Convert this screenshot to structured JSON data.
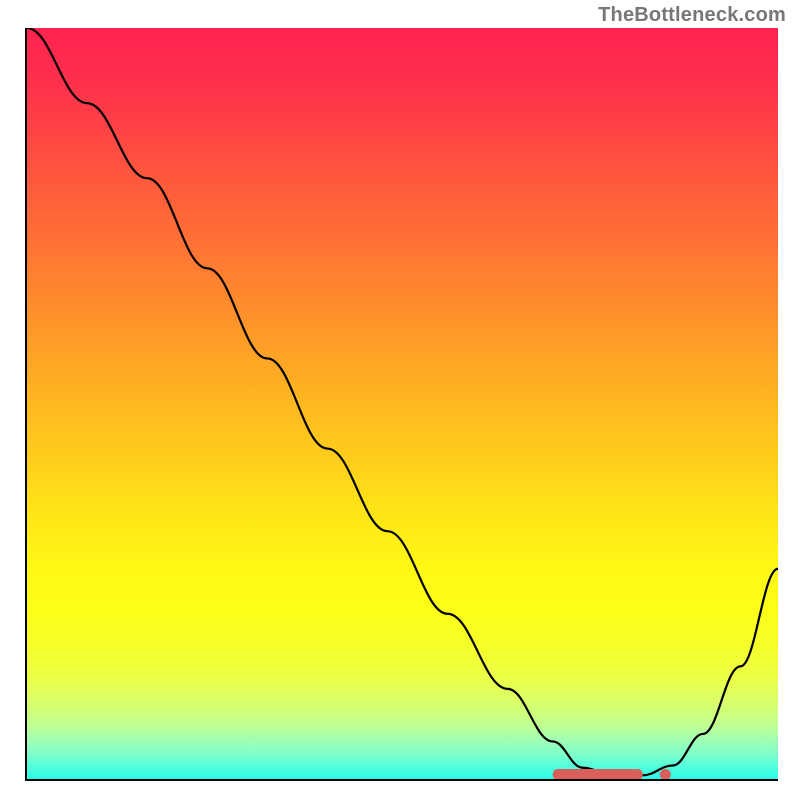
{
  "attribution": "TheBottleneck.com",
  "chart_data": {
    "type": "line",
    "title": "",
    "xlabel": "",
    "ylabel": "",
    "xlim": [
      0,
      100
    ],
    "ylim": [
      0,
      100
    ],
    "grid": false,
    "legend": false,
    "series": [
      {
        "name": "bottleneck-curve",
        "x": [
          0,
          8,
          16,
          24,
          32,
          40,
          48,
          56,
          64,
          70,
          74,
          78,
          82,
          86,
          90,
          95,
          100
        ],
        "y": [
          100,
          90,
          80,
          68,
          56,
          44,
          33,
          22,
          12,
          5,
          1.5,
          0.5,
          0.5,
          1.8,
          6,
          15,
          28
        ]
      }
    ],
    "markers": [
      {
        "name": "optimal-range-bar",
        "x_start": 70,
        "x_end": 82,
        "y": 0.6
      },
      {
        "name": "optimal-point-dot",
        "x": 85,
        "y": 0.6
      }
    ],
    "colors": {
      "gradient_top": "#ff2350",
      "gradient_bottom": "#28ffe6",
      "curve": "#000000",
      "marker": "#d9605a"
    }
  }
}
